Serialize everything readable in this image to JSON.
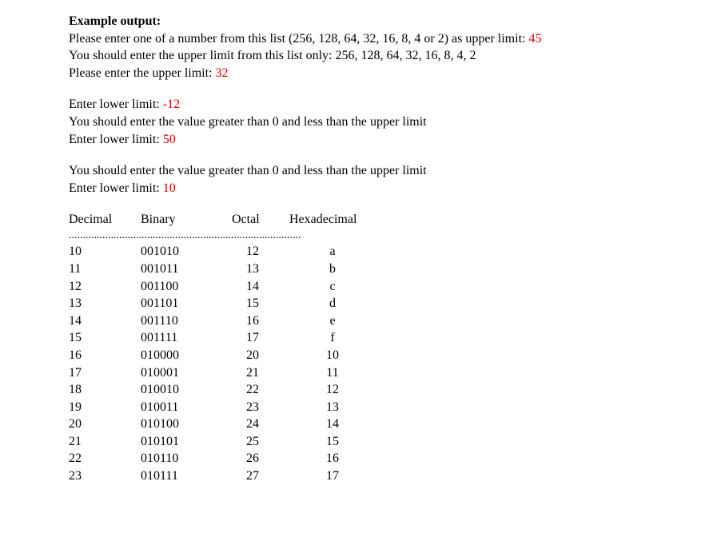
{
  "heading": "Example output:",
  "block1": {
    "line1_prefix": "Please enter one of a number from this list (256, 128, 64, 32, 16, 8, 4 or 2) as upper limit: ",
    "line1_value": "45",
    "line2": "You should enter the upper limit from this list only: 256, 128, 64, 32, 16, 8, 4, 2",
    "line3_prefix": "Please enter the upper limit: ",
    "line3_value": "32"
  },
  "block2": {
    "line1_prefix": "Enter lower limit:  ",
    "line1_value": "-12",
    "line2": "You should enter the value greater than 0 and less than the upper limit",
    "line3_prefix": "Enter lower limit:  ",
    "line3_value": "50"
  },
  "block3": {
    "line1": "You should enter the value greater than 0 and less than the upper limit",
    "line2_prefix": "Enter lower limit:  ",
    "line2_value": "10"
  },
  "headers": {
    "decimal": "Decimal",
    "binary": "Binary",
    "octal": "Octal",
    "hex": "Hexadecimal"
  },
  "divider": "...................................................................................",
  "chart_data": {
    "type": "table",
    "columns": [
      "Decimal",
      "Binary",
      "Octal",
      "Hexadecimal"
    ],
    "rows": [
      {
        "decimal": "10",
        "binary": "001010",
        "octal": "12",
        "hex": "a"
      },
      {
        "decimal": "11",
        "binary": "001011",
        "octal": "13",
        "hex": "b"
      },
      {
        "decimal": "12",
        "binary": "001100",
        "octal": "14",
        "hex": "c"
      },
      {
        "decimal": "13",
        "binary": "001101",
        "octal": "15",
        "hex": "d"
      },
      {
        "decimal": "14",
        "binary": "001110",
        "octal": "16",
        "hex": "e"
      },
      {
        "decimal": "15",
        "binary": "001111",
        "octal": "17",
        "hex": "f"
      },
      {
        "decimal": "16",
        "binary": "010000",
        "octal": "20",
        "hex": "10"
      },
      {
        "decimal": "17",
        "binary": "010001",
        "octal": "21",
        "hex": "11"
      },
      {
        "decimal": "18",
        "binary": "010010",
        "octal": "22",
        "hex": "12"
      },
      {
        "decimal": "19",
        "binary": "010011",
        "octal": "23",
        "hex": "13"
      },
      {
        "decimal": "20",
        "binary": "010100",
        "octal": "24",
        "hex": "14"
      },
      {
        "decimal": "21",
        "binary": "010101",
        "octal": "25",
        "hex": "15"
      },
      {
        "decimal": "22",
        "binary": "010110",
        "octal": "26",
        "hex": "16"
      },
      {
        "decimal": "23",
        "binary": "010111",
        "octal": "27",
        "hex": "17"
      }
    ]
  }
}
